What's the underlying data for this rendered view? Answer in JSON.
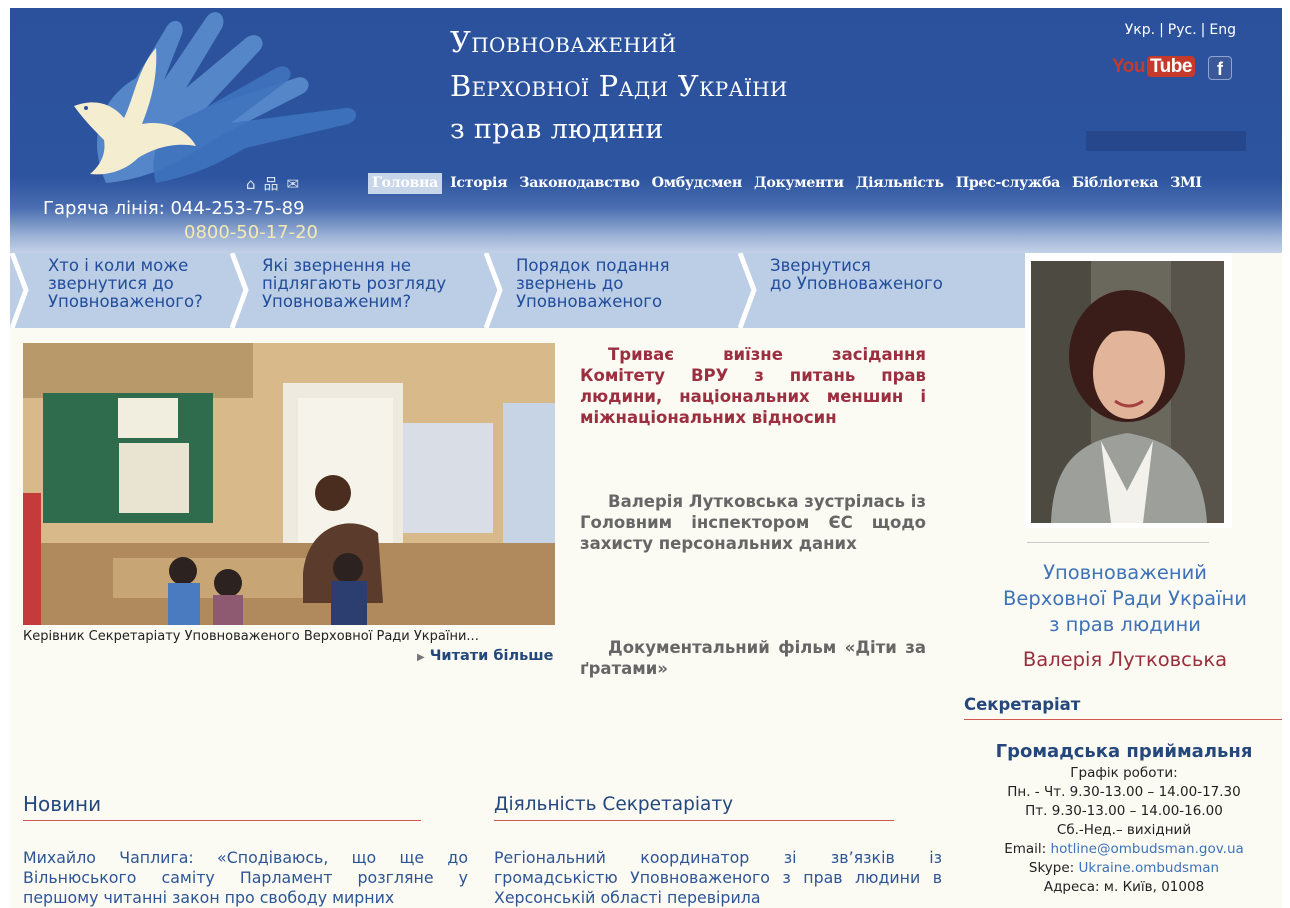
{
  "header": {
    "title_lines": [
      "Уповноважений",
      "Верховної Ради України",
      "з прав людини"
    ],
    "languages": [
      "Укр.",
      "Рус.",
      "Eng"
    ],
    "language_separator": "|",
    "youtube_you": "You",
    "youtube_tube": "Tube",
    "facebook": "f",
    "hotline_label": "Гаряча лінія: 044-253-75-89",
    "hotline_second": "0800-50-17-20",
    "util_icons": [
      "home-icon",
      "sitemap-icon",
      "mail-icon"
    ],
    "util_glyphs": [
      "⌂",
      "品",
      "✉"
    ]
  },
  "nav": {
    "items": [
      "Головна",
      "Історія",
      "Законодавство",
      "Омбудсмен",
      "Документи",
      "Діяльність",
      "Прес-служба",
      "Бібліотека",
      "ЗМІ"
    ],
    "active": "Головна"
  },
  "questions": [
    [
      "Хто і коли може",
      "звернутися до",
      "Уповноваженого?"
    ],
    [
      "Які звернення не",
      "підлягають розгляду",
      "Уповноваженим?"
    ],
    [
      "Порядок подання",
      "звернень до",
      "Уповноваженого"
    ],
    [
      "Звернутися",
      "до Уповноваженого"
    ]
  ],
  "slideshow": {
    "caption": "Керівник Секретаріату Уповноваженого Верховної Ради України...",
    "read_more": "Читати більше"
  },
  "headlines": [
    "Триває виїзне засідання Комітету ВРУ з питань прав людини, національних меншин і міжнаціональних відносин",
    "Валерія Лутковська зустрілась із Головним інспектором ЄС щодо захисту персональних даних",
    "Документальний фільм «Діти за ґратами»"
  ],
  "ombudsman": {
    "title_lines": [
      "Уповноважений",
      "Верховної Ради України",
      "з прав людини"
    ],
    "name": "Валерія Лутковська"
  },
  "sidebar": {
    "secretariat": "Секретаріат",
    "reception_title": "Громадська приймальня",
    "schedule_label": "Графік роботи:",
    "schedule_1": "Пн. - Чт. 9.30-13.00 – 14.00-17.30",
    "schedule_2": "Пт. 9.30-13.00 – 14.00-16.00",
    "schedule_3": "Сб.-Нед.– вихідний",
    "email_label": "Email:",
    "email": "hotline@ombudsman.gov.ua",
    "skype_label": "Skype:",
    "skype": "Ukraine.ombudsman",
    "address": "Адреса: м. Київ, 01008"
  },
  "news": {
    "title": "Новини",
    "text": "Михайло Чаплига: «Сподіваюсь, що ще до Вільнюського саміту Парламент розгляне у першому читанні закон про свободу мирних"
  },
  "activity": {
    "title": "Діяльність Секретаріату",
    "text": "Регіональний координатор зі зв’язків із громадськістю Уповноваженого з прав людини в Херсонській області перевірила"
  }
}
